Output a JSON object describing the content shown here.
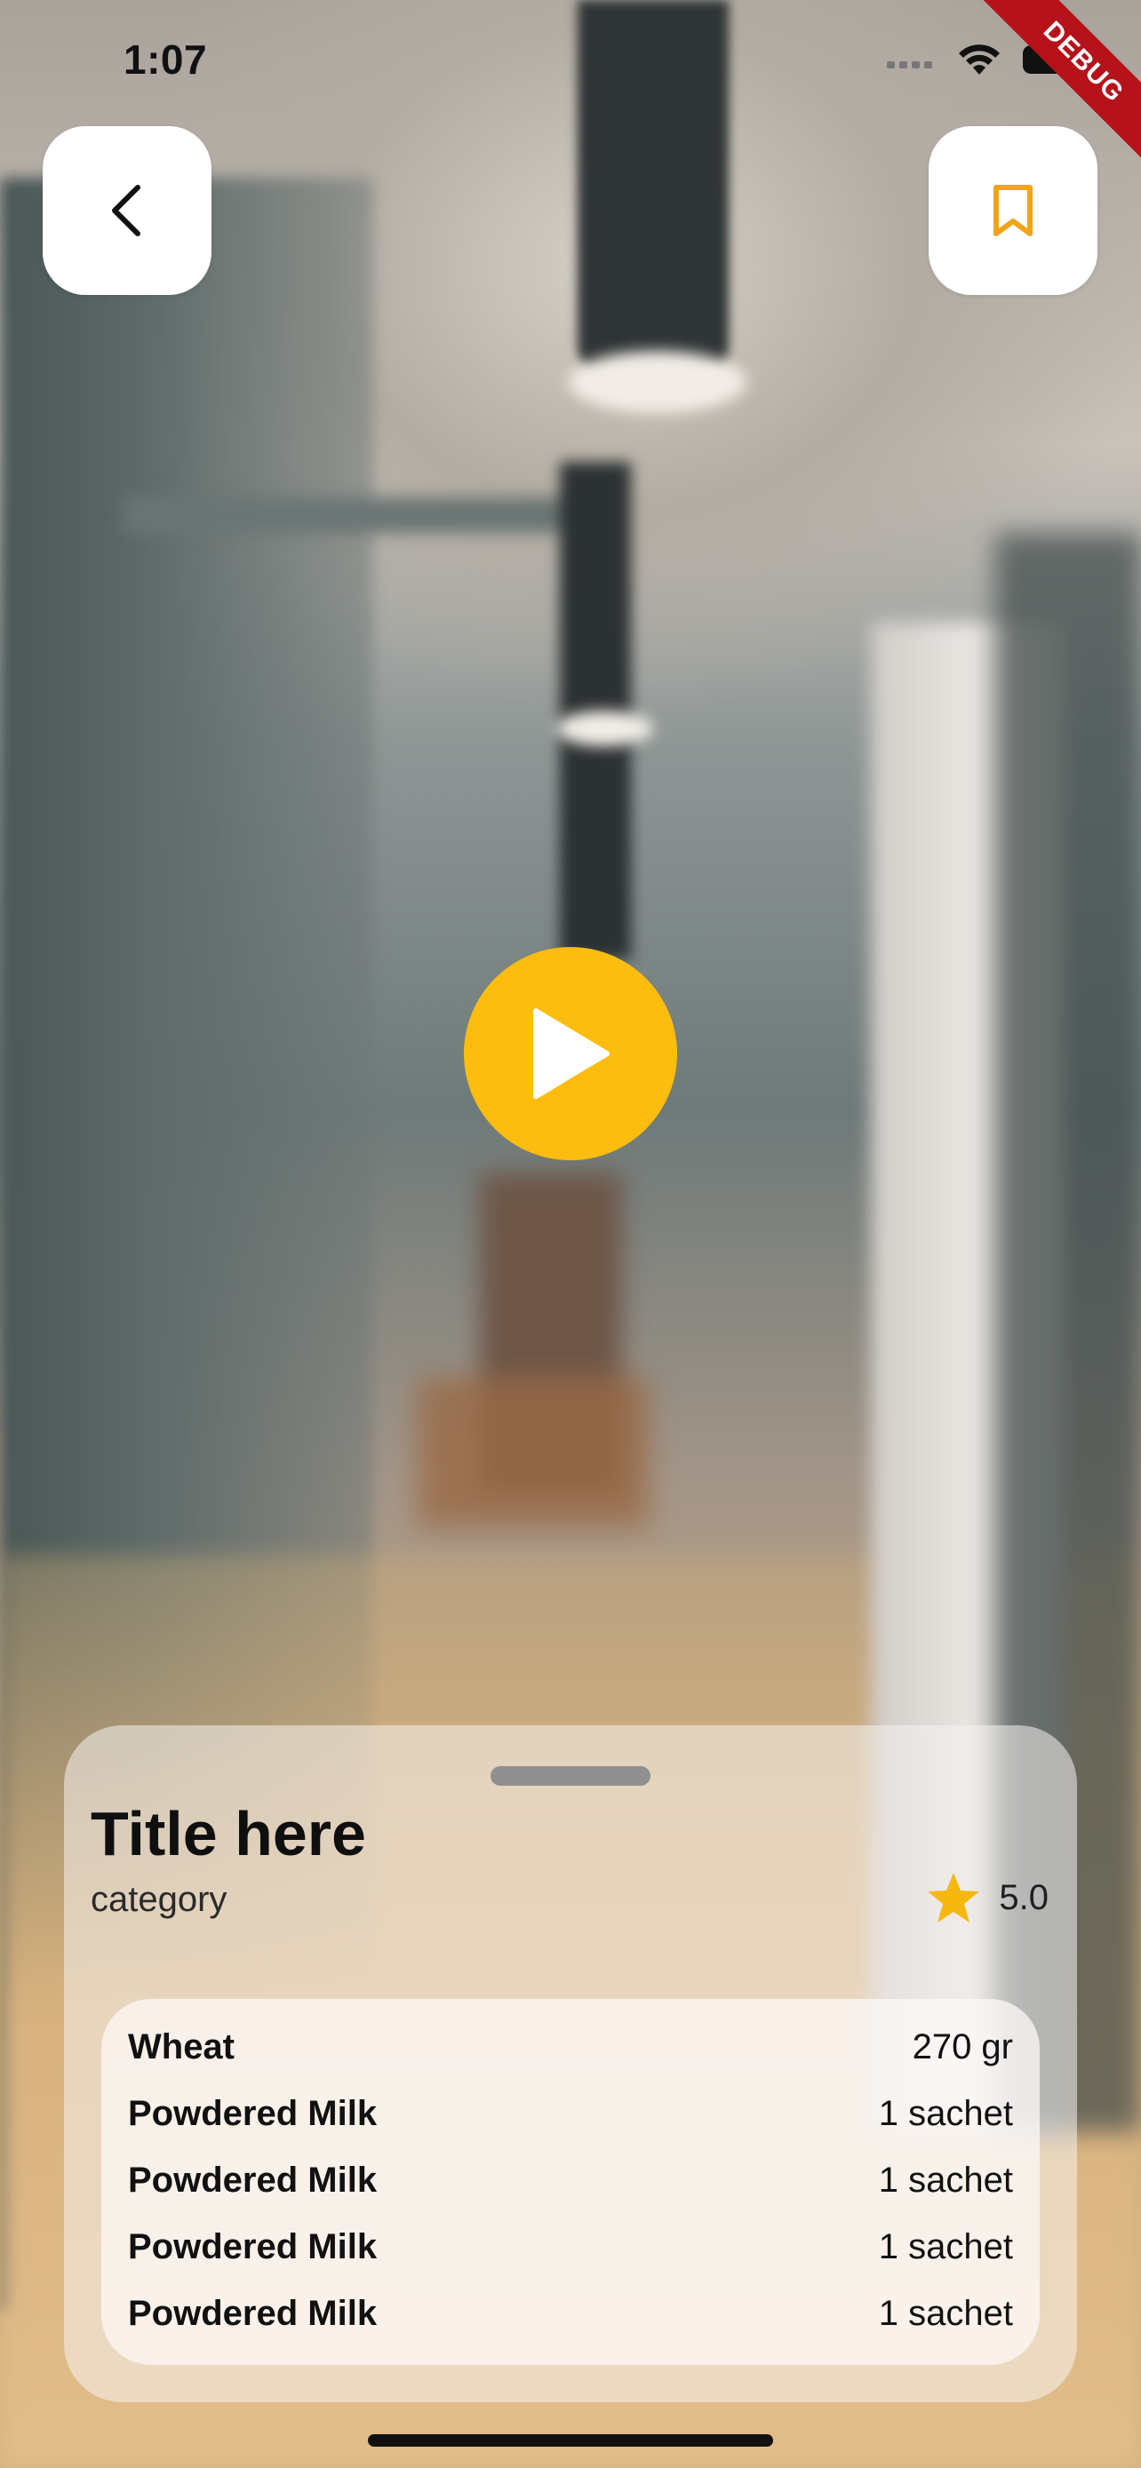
{
  "status_bar": {
    "time": "1:07"
  },
  "debug_banner": "DEBUG",
  "colors": {
    "accent": "#fdbd0f",
    "star": "#f6b70f",
    "sheet": "#f5f3f0"
  },
  "header": {
    "back_icon": "chevron-left-icon",
    "bookmark_icon": "bookmark-icon"
  },
  "player": {
    "play_icon": "play-icon"
  },
  "details": {
    "title": "Title here",
    "category": "category",
    "rating": "5.0",
    "ingredients": [
      {
        "name": "Wheat",
        "quantity": "270 gr"
      },
      {
        "name": "Powdered Milk",
        "quantity": "1 sachet"
      },
      {
        "name": "Powdered Milk",
        "quantity": "1 sachet"
      },
      {
        "name": "Powdered Milk",
        "quantity": "1 sachet"
      },
      {
        "name": "Powdered Milk",
        "quantity": "1 sachet"
      }
    ]
  }
}
